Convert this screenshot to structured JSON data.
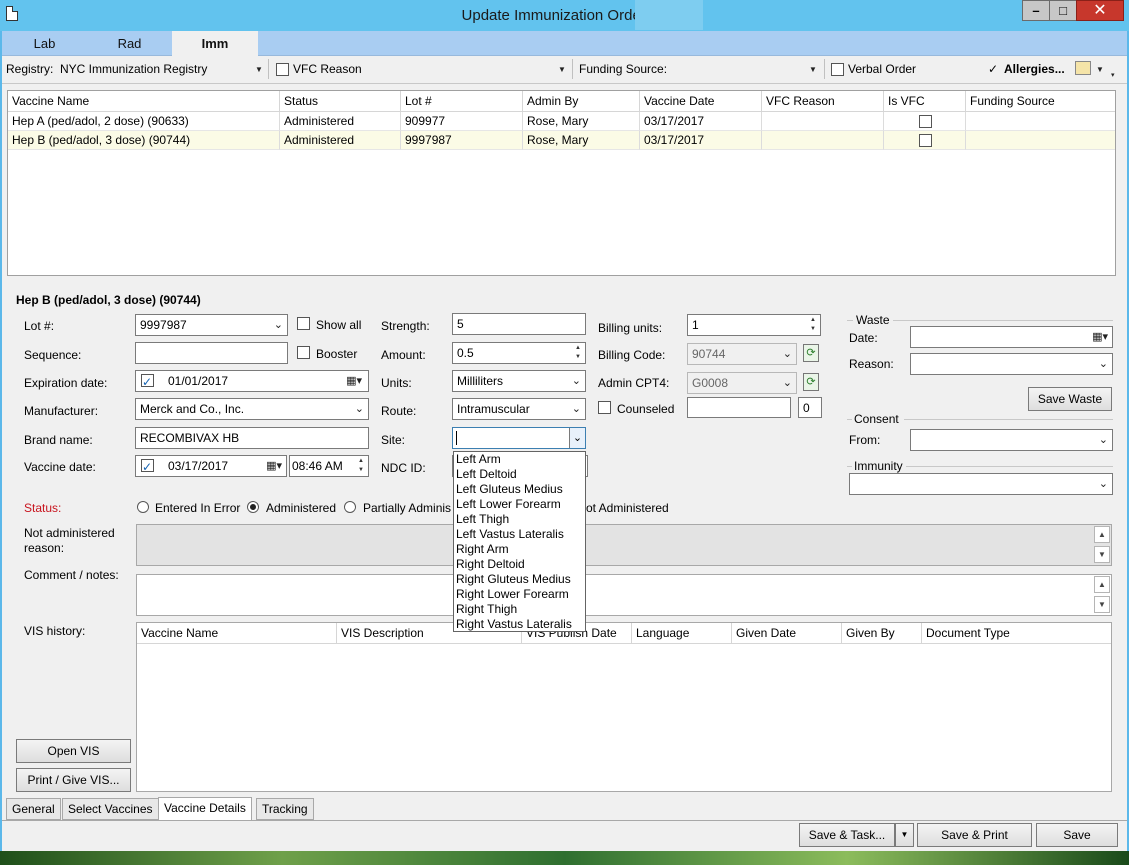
{
  "window": {
    "title": "Update Immunization Order for",
    "minimize": "–",
    "maximize": "□",
    "close": "✕"
  },
  "top_tabs": [
    "Lab",
    "Rad",
    "Imm"
  ],
  "toolbar": {
    "registry_label": "Registry:",
    "registry_value": "NYC Immunization Registry",
    "vfc_reason_label": "VFC Reason",
    "funding_source_label": "Funding Source:",
    "verbal_order_label": "Verbal Order",
    "allergies_check": "✓",
    "allergies_label": "Allergies..."
  },
  "grid": {
    "columns": [
      "Vaccine Name",
      "Status",
      "Lot #",
      "Admin By",
      "Vaccine Date",
      "VFC Reason",
      "Is VFC",
      "Funding Source"
    ],
    "rows": [
      {
        "vaccine": "Hep A (ped/adol, 2 dose) (90633)",
        "status": "Administered",
        "lot": "909977",
        "admin_by": "Rose, Mary",
        "date": "03/17/2017",
        "vfc_reason": "",
        "funding": ""
      },
      {
        "vaccine": "Hep B (ped/adol, 3 dose) (90744)",
        "status": "Administered",
        "lot": "9997987",
        "admin_by": "Rose, Mary",
        "date": "03/17/2017",
        "vfc_reason": "",
        "funding": ""
      }
    ]
  },
  "details": {
    "heading": "Hep B (ped/adol, 3 dose) (90744)",
    "lot_label": "Lot #:",
    "lot_value": "9997987",
    "show_all_label": "Show all",
    "sequence_label": "Sequence:",
    "booster_label": "Booster",
    "expiration_label": "Expiration date:",
    "expiration_value": "01/01/2017",
    "manufacturer_label": "Manufacturer:",
    "manufacturer_value": "Merck and Co., Inc.",
    "brand_label": "Brand name:",
    "brand_value": "RECOMBIVAX HB",
    "vaccine_date_label": "Vaccine date:",
    "vaccine_date_value": "03/17/2017",
    "vaccine_time_value": "08:46 AM",
    "strength_label": "Strength:",
    "strength_value": "5",
    "amount_label": "Amount:",
    "amount_value": "0.5",
    "units_label": "Units:",
    "units_value": "Milliliters",
    "route_label": "Route:",
    "route_value": "Intramuscular",
    "site_label": "Site:",
    "ndc_label": "NDC ID:",
    "billing_units_label": "Billing units:",
    "billing_units_value": "1",
    "billing_code_label": "Billing Code:",
    "billing_code_value": "90744",
    "admin_cpt4_label": "Admin CPT4:",
    "admin_cpt4_value": "G0008",
    "counseled_label": "Counseled",
    "counseled_count": "0",
    "status_label": "Status:",
    "status_options": [
      "Entered In Error",
      "Administered",
      "Partially Adminis",
      "ot Administered"
    ],
    "not_admin_label_1": "Not administered",
    "not_admin_label_2": "reason:",
    "comment_label": "Comment / notes:",
    "vis_history_label": "VIS history:",
    "open_vis": "Open VIS",
    "print_vis": "Print / Give VIS..."
  },
  "site_options": [
    "Left Arm",
    "Left Deltoid",
    "Left Gluteus Medius",
    "Left Lower Forearm",
    "Left Thigh",
    "Left Vastus Lateralis",
    "Right Arm",
    "Right Deltoid",
    "Right Gluteus Medius",
    "Right Lower Forearm",
    "Right Thigh",
    "Right Vastus Lateralis"
  ],
  "waste": {
    "group_label": "Waste",
    "date_label": "Date:",
    "reason_label": "Reason:",
    "save_button": "Save Waste"
  },
  "consent": {
    "group_label": "Consent",
    "from_label": "From:"
  },
  "immunity": {
    "group_label": "Immunity"
  },
  "vis_grid": {
    "columns": [
      "Vaccine Name",
      "VIS Description",
      "VIS Publish Date",
      "Language",
      "Given Date",
      "Given By",
      "Document Type"
    ]
  },
  "bottom_tabs": [
    "General",
    "Select Vaccines",
    "Vaccine Details",
    "Tracking"
  ],
  "footer": {
    "save_task": "Save & Task...",
    "save_print": "Save & Print",
    "save": "Save"
  }
}
